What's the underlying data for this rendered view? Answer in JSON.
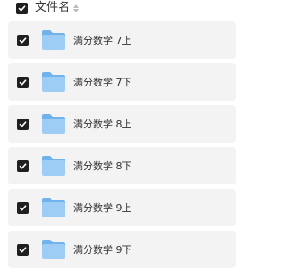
{
  "header": {
    "label": "文件名",
    "checked": true
  },
  "rows": [
    {
      "name": "满分数学 7上",
      "checked": true
    },
    {
      "name": "满分数学 7下",
      "checked": true
    },
    {
      "name": "满分数学 8上",
      "checked": true
    },
    {
      "name": "满分数学 8下",
      "checked": true
    },
    {
      "name": "满分数学 9上",
      "checked": true
    },
    {
      "name": "满分数学 9下",
      "checked": true
    }
  ],
  "colors": {
    "checkbox": "#1f1f1f",
    "row_bg": "#f3f3f3",
    "folder": "#8cc4f2"
  }
}
